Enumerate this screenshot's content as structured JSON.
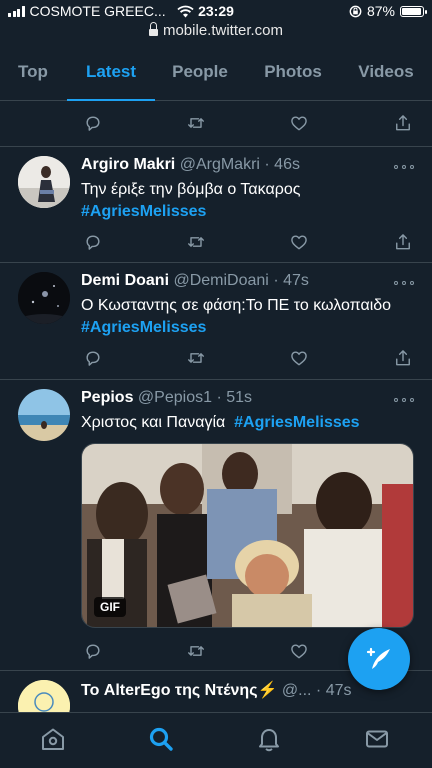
{
  "status_bar": {
    "carrier": "COSMOTE GREEC...",
    "time": "23:29",
    "battery": "87%",
    "battery_level": 0.87
  },
  "browser": {
    "url": "mobile.twitter.com"
  },
  "tabs": [
    {
      "label": "Top",
      "active": false
    },
    {
      "label": "Latest",
      "active": true
    },
    {
      "label": "People",
      "active": false
    },
    {
      "label": "Photos",
      "active": false
    },
    {
      "label": "Videos",
      "active": false
    }
  ],
  "tweets": [
    {
      "name": "Argiro Makri",
      "handle": "@ArgMakri",
      "time": "· 46s",
      "text": "Την έριξε την βόμβα ο Τακαρος",
      "hashtag": "#AgriesMelisses"
    },
    {
      "name": "Demi Doani",
      "handle": "@DemiDoani",
      "time": "· 47s",
      "text": "Ο Κωσταντης σε φάση:Το ΠΕ το κωλοπαιδο",
      "hashtag": "#AgriesMelisses"
    },
    {
      "name": "Pepios",
      "handle": "@Pepios1",
      "time": "· 51s",
      "text": "Χριστος και Παναγία",
      "hashtag": "#AgriesMelisses",
      "media_badge": "GIF"
    },
    {
      "name": "Το AlterEgo της Ντένης⚡",
      "handle": "@...",
      "time": "· 47s"
    }
  ],
  "colors": {
    "background": "#15202b",
    "accent": "#1da1f2",
    "muted": "#8899a6",
    "divider": "#38444d"
  },
  "icons": {
    "actions": [
      "reply-icon",
      "retweet-icon",
      "like-icon",
      "share-icon"
    ],
    "nav": [
      "home-icon",
      "search-icon",
      "notifications-icon",
      "messages-icon"
    ],
    "fab": "compose-tweet-icon"
  }
}
